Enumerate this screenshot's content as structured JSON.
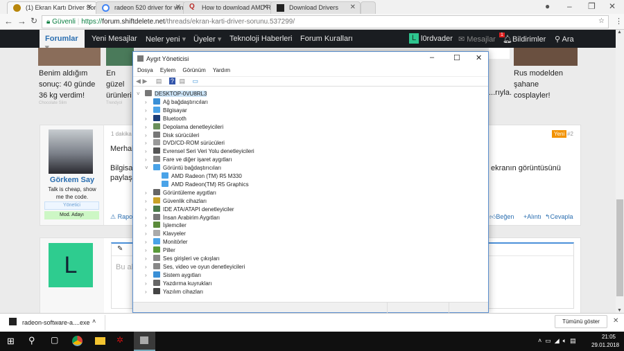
{
  "browser": {
    "tabs": [
      {
        "label": "(1) Ekran Kartı Driver Sorunu",
        "active": true
      },
      {
        "label": "radeon 520 driver for win"
      },
      {
        "label": "How to download AMD R"
      },
      {
        "label": "Download Drivers"
      }
    ],
    "secure_label": "Güvenli",
    "url_scheme": "https://",
    "url_domain": "forum.shiftdelete.net",
    "url_path": "/threads/ekran-karti-driver-sorunu.537299/"
  },
  "nav": {
    "items": [
      "Forumlar",
      "Yeni Mesajlar",
      "Neler yeni",
      "Üyeler",
      "Teknoloji Haberleri",
      "Forum Kuralları"
    ],
    "user_initial": "L",
    "username": "l0rdvader",
    "messages": "Mesajlar",
    "notif_count": "1",
    "notifications": "Bildirimler",
    "search": "Ara"
  },
  "ads": [
    {
      "title": "Benim aldığım sonuç: 40 günde 36 kg verdim!",
      "source": "Chocolate Slim"
    },
    {
      "title": "En güzel ürünleri başlayan",
      "source": "Trendyol"
    },
    {
      "title": "...rıyla."
    },
    {
      "title": "Rus modelden şahane cosplayler!"
    }
  ],
  "post": {
    "author": "Görkem Say",
    "signature": "Talk is cheap, show me the code.",
    "role1": "Yönetici",
    "role2": "Mod. Adayı",
    "time": "1 dakika",
    "body1": "Merhab",
    "body2": "Bilgisay",
    "body3": "paylaşa",
    "body_right": "ekranın görüntüsünü",
    "badge": "Yeni",
    "number": "#2",
    "report": "Rapo",
    "like": "Beğen",
    "quote": "Alıntı",
    "reply": "Cevapla"
  },
  "reply": {
    "initial": "L",
    "placeholder": "Bu ala"
  },
  "devmgr": {
    "title": "Aygıt Yöneticisi",
    "menu": [
      "Dosya",
      "Eylem",
      "Görünüm",
      "Yardım"
    ],
    "root": "DESKTOP-0VU8RL3",
    "items": [
      {
        "label": "Ağ bağdaştırıcıları",
        "color": "#3a8fd6"
      },
      {
        "label": "Bilgisayar",
        "color": "#4aa3e8"
      },
      {
        "label": "Bluetooth",
        "color": "#1c3e7a"
      },
      {
        "label": "Depolama denetleyicileri",
        "color": "#6a8f5a"
      },
      {
        "label": "Disk sürücüleri",
        "color": "#777"
      },
      {
        "label": "DVD/CD-ROM sürücüleri",
        "color": "#999"
      },
      {
        "label": "Evrensel Seri Veri Yolu denetleyicileri",
        "color": "#555"
      },
      {
        "label": "Fare ve diğer işaret aygıtları",
        "color": "#888"
      },
      {
        "label": "Görüntü bağdaştırıcıları",
        "color": "#4aa3e8",
        "expanded": true,
        "children": [
          "AMD Radeon (TM) R5 M330",
          "AMD Radeon(TM) R5 Graphics"
        ]
      },
      {
        "label": "Görüntüleme aygıtları",
        "color": "#666"
      },
      {
        "label": "Güvenlik cihazları",
        "color": "#c9a227"
      },
      {
        "label": "IDE ATA/ATAPI denetleyiciler",
        "color": "#4a7a4a"
      },
      {
        "label": "İnsan Arabirim Aygıtları",
        "color": "#777"
      },
      {
        "label": "İşlemciler",
        "color": "#5a8a3a"
      },
      {
        "label": "Klavyeler",
        "color": "#aaa"
      },
      {
        "label": "Monitörler",
        "color": "#4aa3e8"
      },
      {
        "label": "Piller",
        "color": "#5a9a3a"
      },
      {
        "label": "Ses girişleri ve çıkışları",
        "color": "#888"
      },
      {
        "label": "Ses, video ve oyun denetleyicileri",
        "color": "#888"
      },
      {
        "label": "Sistem aygıtları",
        "color": "#3a8fd6"
      },
      {
        "label": "Yazdırma kuyrukları",
        "color": "#666"
      },
      {
        "label": "Yazılım cihazları",
        "color": "#444"
      }
    ]
  },
  "download": {
    "file": "radeon-software-a....exe",
    "show_all": "Tümünü göster"
  },
  "taskbar": {
    "time": "21:05",
    "date": "29.01.2018"
  }
}
